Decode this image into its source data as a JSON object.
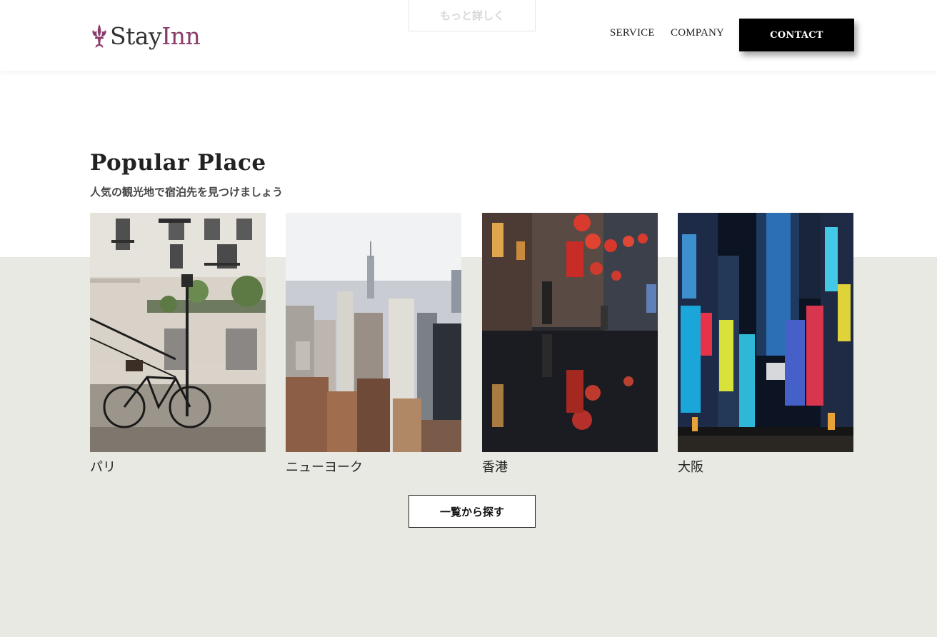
{
  "header": {
    "logo_part1": "Stay",
    "logo_part2": "Inn",
    "logo_icon": "fleur-de-lis-icon",
    "ghost_button": "もっと詳しく",
    "nav": [
      "SERVICE",
      "COMPANY"
    ],
    "contact_button": "CONTACT"
  },
  "section": {
    "title": "Popular Place",
    "subtitle": "人気の観光地で宿泊先を見つけましょう"
  },
  "places": [
    {
      "name": "パリ"
    },
    {
      "name": "ニューヨーク"
    },
    {
      "name": "香港"
    },
    {
      "name": "大阪"
    }
  ],
  "browse_button": "一覧から探す",
  "colors": {
    "brand": "#8a3d6b",
    "band_background": "#e9e9e4",
    "contact_bg": "#000000"
  }
}
